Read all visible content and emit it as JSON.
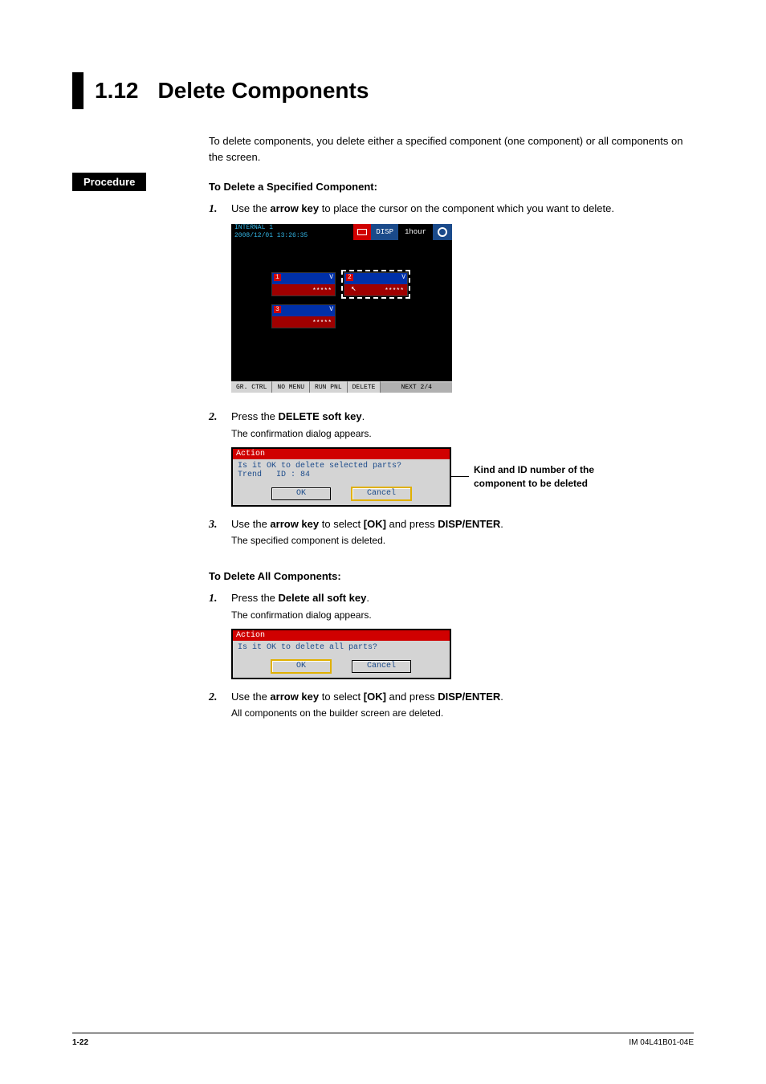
{
  "heading": {
    "num": "1.12",
    "title": "Delete Components"
  },
  "intro": "To delete components, you delete either a specified component (one component) or all components on the screen.",
  "procedure_label": "Procedure",
  "sectionA": {
    "title": "To Delete a Specified Component:",
    "steps": [
      {
        "n": "1.",
        "pre": "Use the ",
        "b1": "arrow key",
        "post": " to place the cursor on the component which you want to delete."
      },
      {
        "n": "2.",
        "pre": "Press the ",
        "b1": "DELETE soft key",
        "post": ".",
        "sub": "The confirmation dialog appears."
      },
      {
        "n": "3.",
        "pre": "Use the ",
        "b1": "arrow key",
        "mid": " to select ",
        "b2": "[OK]",
        "mid2": " and press ",
        "b3": "DISP/ENTER",
        "post": ".",
        "sub": "The specified component is deleted."
      }
    ]
  },
  "sectionB": {
    "title": "To Delete All Components:",
    "steps": [
      {
        "n": "1.",
        "pre": "Press the ",
        "b1": "Delete all soft key",
        "post": ".",
        "sub": "The confirmation dialog appears."
      },
      {
        "n": "2.",
        "pre": "Use the ",
        "b1": "arrow key",
        "mid": " to select ",
        "b2": "[OK]",
        "mid2": " and press ",
        "b3": "DISP/ENTER",
        "post": ".",
        "sub": "All components on the builder screen are deleted."
      }
    ]
  },
  "shot1": {
    "name_line1": "INTERNAL 1",
    "name_line2": "2008/12/01 13:26:35",
    "icon_label": "DSP",
    "disp": "DISP",
    "time": "1hour",
    "boxes": [
      {
        "n": "1",
        "v": "V",
        "stars": "*****"
      },
      {
        "n": "2",
        "v": "V",
        "stars": "*****"
      },
      {
        "n": "3",
        "v": "V",
        "stars": "*****"
      }
    ],
    "softkeys": [
      "GR. CTRL",
      "NO MENU",
      "RUN PNL",
      "DELETE",
      "NEXT 2/4"
    ]
  },
  "dialogA": {
    "title": "Action",
    "msg": "Is it OK to delete selected parts?",
    "sub_kind": "Trend",
    "sub_id": "ID : 84",
    "ok": "OK",
    "cancel": "Cancel"
  },
  "calloutA": {
    "line1": "Kind and ID number of the",
    "line2": "component to be deleted"
  },
  "dialogB": {
    "title": "Action",
    "msg": "Is it OK to delete all parts?",
    "ok": "OK",
    "cancel": "Cancel"
  },
  "footer": {
    "left": "1-22",
    "right": "IM 04L41B01-04E"
  }
}
